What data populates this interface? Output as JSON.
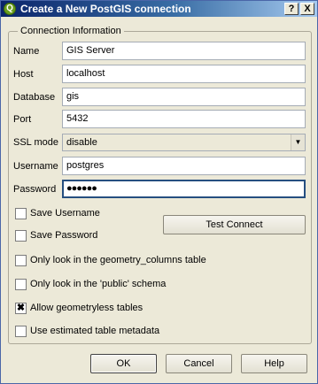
{
  "window": {
    "app_icon": "Q",
    "title": "Create a New PostGIS connection",
    "help_label": "?",
    "close_label": "X"
  },
  "group": {
    "title": "Connection Information"
  },
  "fields": {
    "name": {
      "label": "Name",
      "value": "GIS Server"
    },
    "host": {
      "label": "Host",
      "value": "localhost"
    },
    "database": {
      "label": "Database",
      "value": "gis"
    },
    "port": {
      "label": "Port",
      "value": "5432"
    },
    "ssl_mode": {
      "label": "SSL mode",
      "value": "disable"
    },
    "username": {
      "label": "Username",
      "value": "postgres"
    },
    "password": {
      "label": "Password",
      "value": "●●●●●●"
    }
  },
  "checkboxes": {
    "save_username": {
      "label": "Save Username",
      "checked": false
    },
    "save_password": {
      "label": "Save Password",
      "checked": false
    },
    "geometry_columns": {
      "label": "Only look in the geometry_columns table",
      "checked": false
    },
    "public_schema": {
      "label": "Only look in the 'public' schema",
      "checked": false
    },
    "geometryless": {
      "label": "Allow geometryless tables",
      "checked": true,
      "mark": "✖"
    },
    "estimated_metadata": {
      "label": "Use estimated table metadata",
      "checked": false
    }
  },
  "buttons": {
    "test_connect": "Test Connect",
    "ok": "OK",
    "cancel": "Cancel",
    "help": "Help"
  },
  "icons": {
    "ssl_dropdown": "▼"
  }
}
